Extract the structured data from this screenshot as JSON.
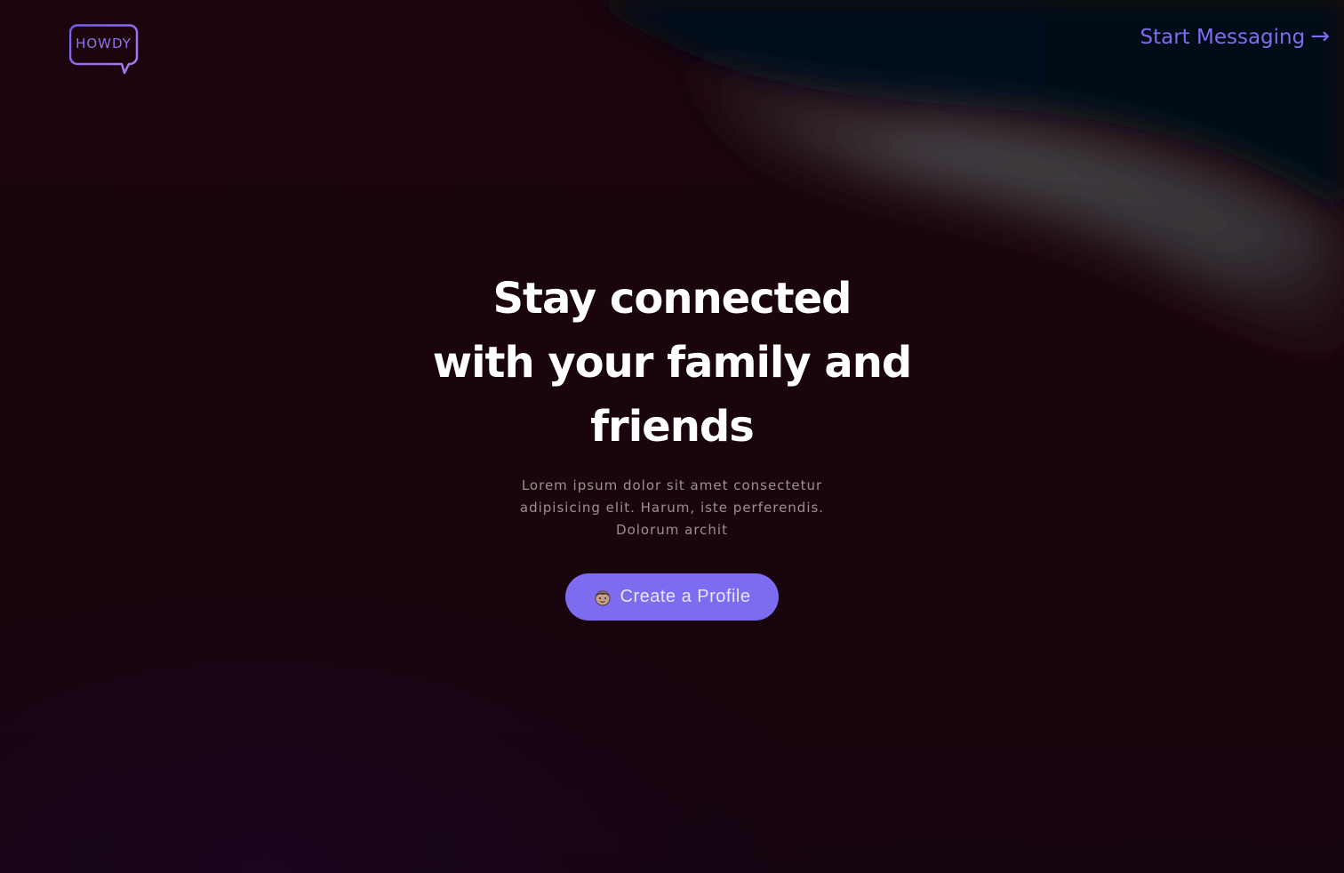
{
  "header": {
    "logo_text": "HOWDY",
    "start_link_label": "Start Messaging",
    "start_link_arrow": "→"
  },
  "hero": {
    "title_line1": "Stay connected",
    "title_line2": "with your family and",
    "title_line3": "friends",
    "subtitle_line1": "Lorem ipsum dolor sit amet consectetur",
    "subtitle_line2": "adipisicing elit. Harum, iste perferendis.",
    "subtitle_line3": "Dolorum archit",
    "cta_label": "Create a Profile",
    "cta_icon": "person-emoji-icon"
  },
  "colors": {
    "background": "#1a050c",
    "accent": "#7e6cf0",
    "title": "#ffffff",
    "subtitle": "#9c8f95"
  }
}
